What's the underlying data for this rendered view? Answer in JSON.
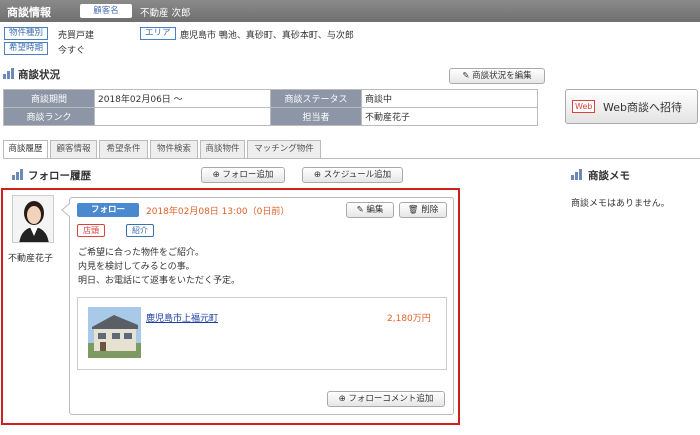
{
  "header": {
    "title": "商談情報",
    "badge": "顧客名",
    "customer_name": "不動産 次郎"
  },
  "info": {
    "type_label": "物件種別",
    "type_value": "売買戸建",
    "area_label": "エリア",
    "area_value": "鹿児島市 鴨池、真砂町、真砂本町、与次郎",
    "timing_label": "希望時期",
    "timing_value": "今すぐ"
  },
  "status_section": {
    "title": "商談状況",
    "edit_button": "商談状況を編集",
    "period_label": "商談期間",
    "period_value": "2018年02月06日 ～",
    "status_label": "商談ステータス",
    "status_value": "商談中",
    "rank_label": "商談ランク",
    "rank_value": "",
    "owner_label": "担当者",
    "owner_value": "不動産花子",
    "web_icon": "Web",
    "web_button": "Web商談へ招待"
  },
  "tabs": [
    "商談履歴",
    "顧客情報",
    "希望条件",
    "物件検索",
    "商談物件",
    "マッチング物件"
  ],
  "follow": {
    "title": "フォロー履歴",
    "add_follow": "フォロー追加",
    "add_schedule": "スケジュール追加",
    "user_name": "不動産花子",
    "entry": {
      "type": "フォロー",
      "datetime": "2018年02月08日 13:00（0日前）",
      "edit": "編集",
      "delete": "削除",
      "tag1": "店頭",
      "tag2": "紹介",
      "line1": "ご希望に合った物件をご紹介。",
      "line2": "内見を検討してみるとの事。",
      "line3": "明日、お電話にて返事をいただく予定。",
      "property_name": "鹿児島市上福元町",
      "property_price": "2,180万円",
      "add_comment": "フォローコメント追加"
    }
  },
  "memo": {
    "title": "商談メモ",
    "empty": "商談メモはありません。"
  },
  "colors": {
    "accent": "#4a89d0",
    "highlight": "#d11f1f",
    "date": "#e0612a",
    "header": "#7a7a7a"
  }
}
